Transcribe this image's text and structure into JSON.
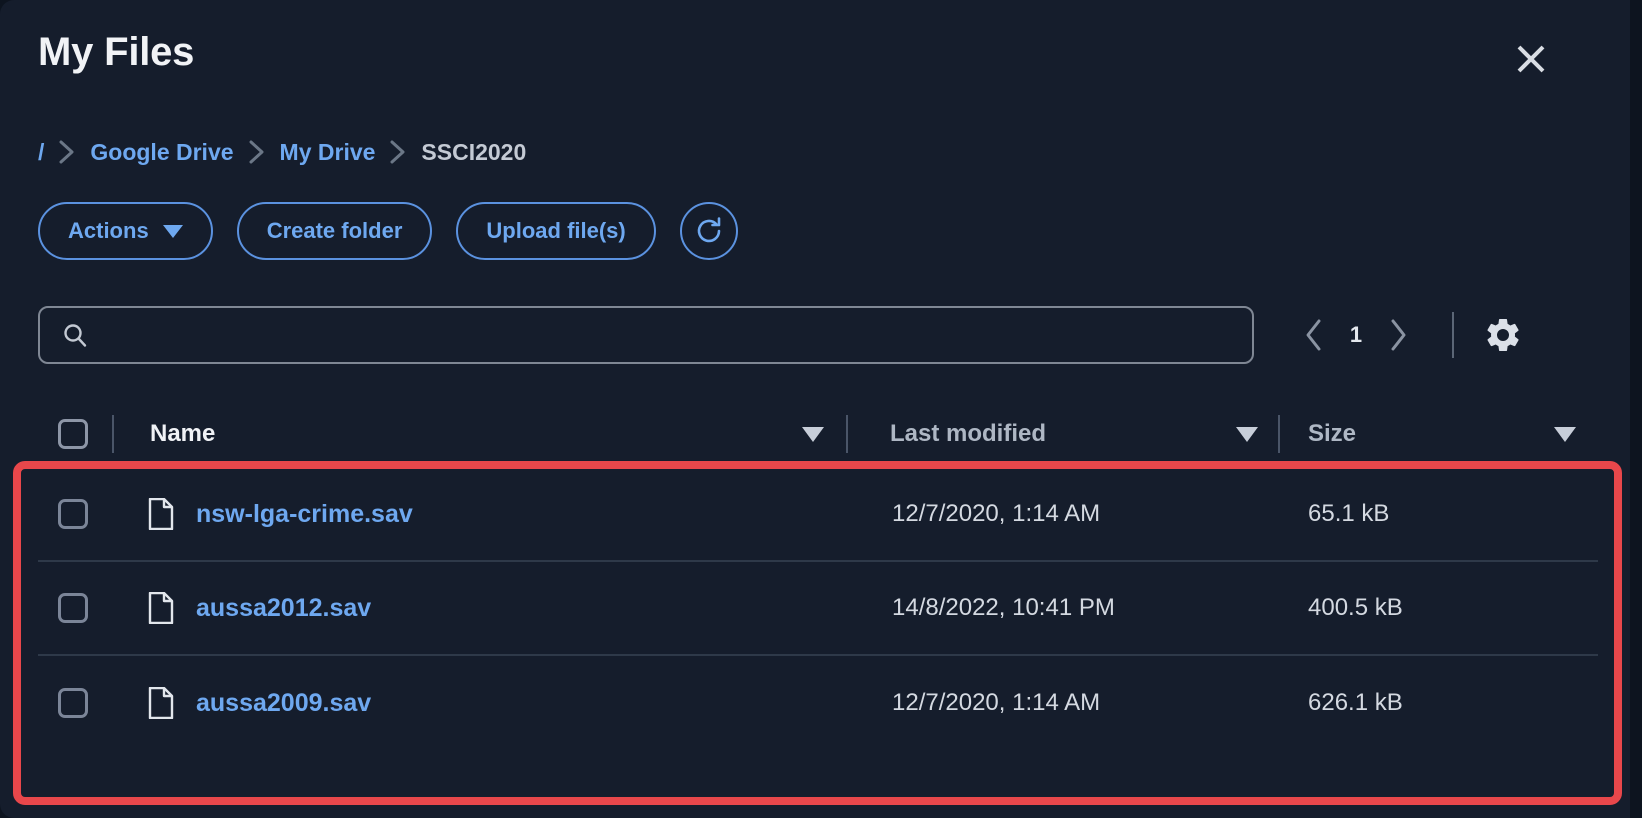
{
  "window": {
    "title": "My Files",
    "close_icon": "close-icon"
  },
  "breadcrumb": {
    "separator_icon": "chevron-right-icon",
    "items": [
      {
        "label": "/",
        "current": false
      },
      {
        "label": "Google Drive",
        "current": false
      },
      {
        "label": "My Drive",
        "current": false
      },
      {
        "label": "SSCI2020",
        "current": true
      }
    ]
  },
  "toolbar": {
    "actions_label": "Actions",
    "actions_caret_icon": "caret-down-icon",
    "create_folder_label": "Create folder",
    "upload_files_label": "Upload file(s)",
    "refresh_icon": "refresh-icon"
  },
  "search": {
    "value": "",
    "placeholder": "",
    "icon": "search-icon"
  },
  "pagination": {
    "prev_icon": "chevron-left-icon",
    "page": "1",
    "next_icon": "chevron-right-icon",
    "settings_icon": "gear-icon"
  },
  "table": {
    "select_all_checkbox": false,
    "columns": [
      {
        "label": "Name",
        "sort_icon": "caret-down-icon",
        "primary": true
      },
      {
        "label": "Last modified",
        "sort_icon": "caret-down-icon",
        "primary": false
      },
      {
        "label": "Size",
        "sort_icon": "caret-down-icon",
        "primary": false
      }
    ],
    "rows": [
      {
        "checked": false,
        "icon": "file-icon",
        "name": "nsw-lga-crime.sav",
        "modified": "12/7/2020, 1:14 AM",
        "size": "65.1 kB"
      },
      {
        "checked": false,
        "icon": "file-icon",
        "name": "aussa2012.sav",
        "modified": "14/8/2022, 10:41 PM",
        "size": "400.5 kB"
      },
      {
        "checked": false,
        "icon": "file-icon",
        "name": "aussa2009.sav",
        "modified": "12/7/2020, 1:14 AM",
        "size": "626.1 kB"
      }
    ]
  },
  "annotation": {
    "highlight_color": "#e8474b"
  },
  "colors": {
    "panel_background": "#151d2c",
    "page_background": "#0d141f",
    "link_blue": "#6ea8f0",
    "border_blue": "#5b92e0",
    "text_primary": "#f0f2f6",
    "text_secondary": "#aeb7c4",
    "row_divider": "#2e3949"
  }
}
